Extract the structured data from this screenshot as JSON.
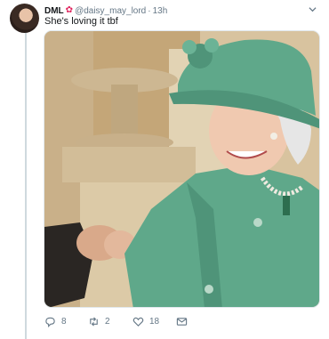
{
  "tweet": {
    "display_name": "DML",
    "handle": "@daisy_may_lord",
    "separator": "·",
    "timestamp": "13h",
    "text": "She's loving it tbf",
    "badge_icon": "flower-emoji-icon"
  },
  "actions": {
    "reply_count": "8",
    "retweet_count": "2",
    "like_count": "18",
    "reply_icon": "reply-icon",
    "retweet_icon": "retweet-icon",
    "like_icon": "heart-icon",
    "dm_icon": "envelope-icon"
  },
  "colors": {
    "text_primary": "#14171a",
    "text_secondary": "#657786",
    "badge": "#e0245e",
    "coat": "#5fa88a"
  }
}
